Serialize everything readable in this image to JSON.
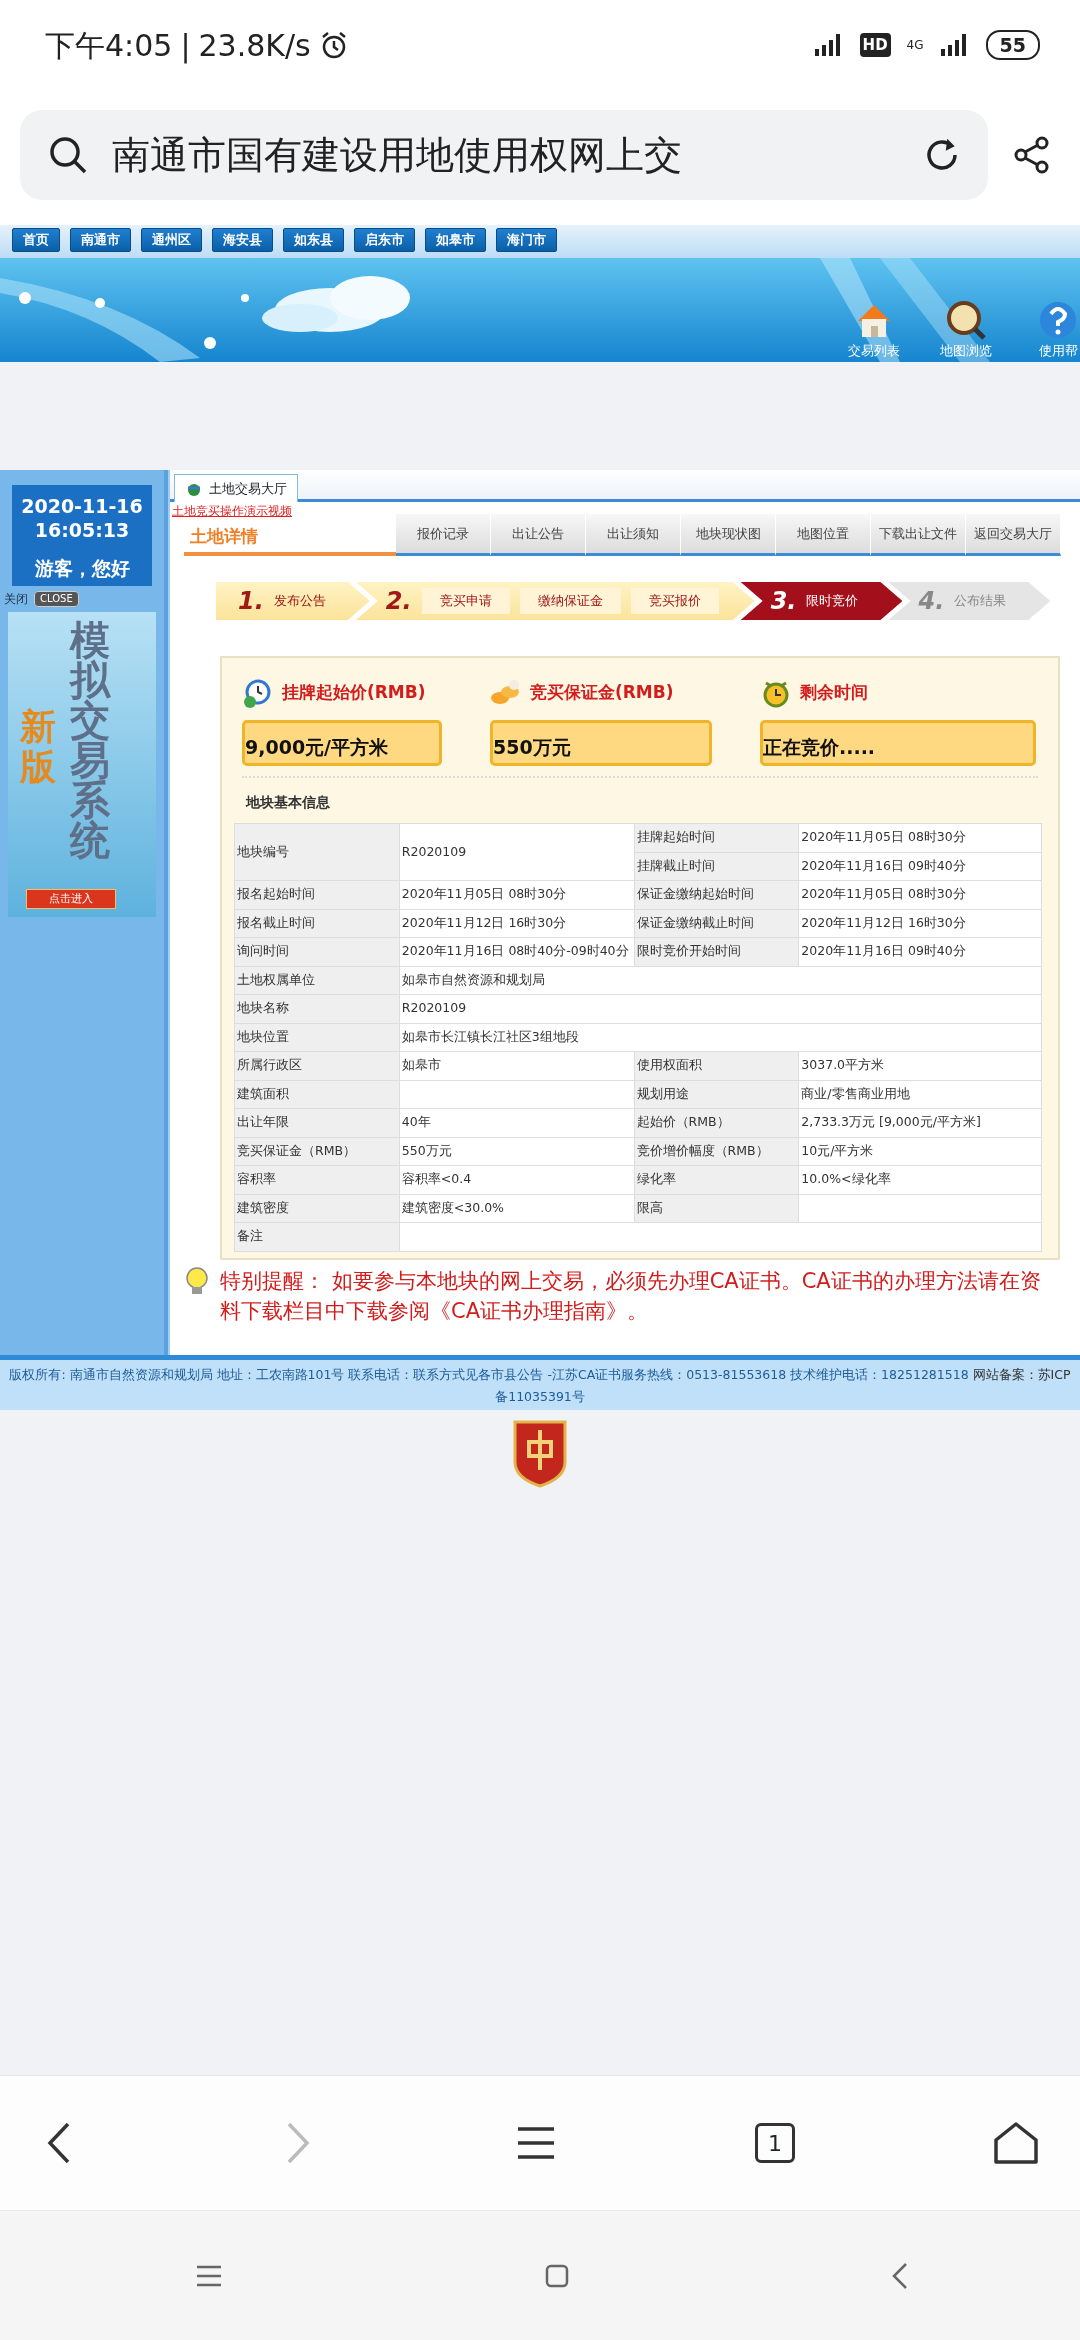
{
  "status_bar": {
    "time": "下午4:05",
    "divider": "|",
    "speed": "23.8K/s",
    "hd": "HD",
    "network": "4G",
    "battery": "55"
  },
  "browser": {
    "title": "南通市国有建设用地使用权网上交"
  },
  "site_nav": [
    {
      "label": "首页"
    },
    {
      "label": "南通市"
    },
    {
      "label": "通州区"
    },
    {
      "label": "海安县"
    },
    {
      "label": "如东县"
    },
    {
      "label": "启东市"
    },
    {
      "label": "如皋市"
    },
    {
      "label": "海门市"
    }
  ],
  "banner_tools": [
    {
      "kind": "house",
      "label": "交易列表"
    },
    {
      "kind": "map",
      "label": "地图浏览"
    },
    {
      "kind": "help",
      "label": "使用帮"
    }
  ],
  "left_panel": {
    "date": "2020-11-16",
    "time": "16:05:13",
    "greeting": "游客，您好",
    "close_label": "关闭",
    "close_button": "CLOSE",
    "ad": {
      "badge": "新版",
      "title": "模拟交易系统",
      "button": "点击进入"
    }
  },
  "main_tab": {
    "label": "土地交易大厅",
    "selected": true
  },
  "video_link": "土地竞买操作演示视频",
  "section_title": "土地详情",
  "detail_tabs": [
    {
      "label": "报价记录"
    },
    {
      "label": "出让公告"
    },
    {
      "label": "出让须知"
    },
    {
      "label": "地块现状图"
    },
    {
      "label": "地图位置"
    },
    {
      "label": "下载出让文件"
    },
    {
      "label": "返回交易大厅"
    }
  ],
  "steps": [
    {
      "num": "1.",
      "done": true,
      "selected": false,
      "labels": [
        "发布公告"
      ]
    },
    {
      "num": "2.",
      "done": true,
      "selected": false,
      "labels": [
        "竞买申请",
        "缴纳保证金",
        "竞买报价"
      ]
    },
    {
      "num": "3.",
      "done": false,
      "selected": true,
      "labels": [
        "限时竞价"
      ]
    },
    {
      "num": "4.",
      "done": false,
      "selected": false,
      "labels": [
        "公布结果"
      ]
    }
  ],
  "summary": [
    {
      "kind": "price",
      "label": "挂牌起始价(RMB)",
      "value": "9,000元/平方米"
    },
    {
      "kind": "deposit",
      "label": "竞买保证金(RMB)",
      "value": "550万元"
    },
    {
      "kind": "time",
      "label": "剩余时间",
      "value": "正在竞价....."
    }
  ],
  "info_title": "地块基本信息",
  "info_rows": [
    [
      {
        "kind": "label",
        "text": "地块编号",
        "tall": true
      },
      {
        "kind": "value",
        "text": "R2020109",
        "tall": true
      },
      {
        "kind": "label",
        "text": "挂牌起始时间"
      },
      {
        "kind": "value",
        "text": "2020年11月05日 08时30分"
      }
    ],
    [
      {
        "kind": "label",
        "text": "挂牌截止时间"
      },
      {
        "kind": "value",
        "text": "2020年11月16日 09时40分"
      }
    ],
    [
      {
        "kind": "label",
        "text": "报名起始时间"
      },
      {
        "kind": "value",
        "text": "2020年11月05日 08时30分"
      },
      {
        "kind": "label",
        "text": "保证金缴纳起始时间"
      },
      {
        "kind": "value",
        "text": "2020年11月05日 08时30分"
      }
    ],
    [
      {
        "kind": "label",
        "text": "报名截止时间"
      },
      {
        "kind": "value",
        "text": "2020年11月12日 16时30分"
      },
      {
        "kind": "label",
        "text": "保证金缴纳截止时间"
      },
      {
        "kind": "value",
        "text": "2020年11月12日 16时30分"
      }
    ],
    [
      {
        "kind": "label",
        "text": "询问时间"
      },
      {
        "kind": "value",
        "text": "2020年11月16日 08时40分-09时40分"
      },
      {
        "kind": "label",
        "text": "限时竞价开始时间"
      },
      {
        "kind": "value",
        "text": "2020年11月16日 09时40分"
      }
    ],
    [
      {
        "kind": "label",
        "text": "土地权属单位"
      },
      {
        "kind": "value",
        "text": "如皋市自然资源和规划局",
        "wide": true
      }
    ],
    [
      {
        "kind": "label",
        "text": "地块名称"
      },
      {
        "kind": "value",
        "text": "R2020109",
        "wide": true
      }
    ],
    [
      {
        "kind": "label",
        "text": "地块位置"
      },
      {
        "kind": "value",
        "text": "如皋市长江镇长江社区3组地段",
        "wide": true
      }
    ],
    [
      {
        "kind": "label",
        "text": "所属行政区"
      },
      {
        "kind": "value",
        "text": "如皋市"
      },
      {
        "kind": "label",
        "text": "使用权面积"
      },
      {
        "kind": "value",
        "text": "3037.0平方米"
      }
    ],
    [
      {
        "kind": "label",
        "text": "建筑面积"
      },
      {
        "kind": "value"
      },
      {
        "kind": "label",
        "text": "规划用途"
      },
      {
        "kind": "value",
        "text": "商业/零售商业用地"
      }
    ],
    [
      {
        "kind": "label",
        "text": "出让年限"
      },
      {
        "kind": "value",
        "text": "40年"
      },
      {
        "kind": "label",
        "text": "起始价（RMB）"
      },
      {
        "kind": "value",
        "text": "2,733.3万元 [9,000元/平方米]"
      }
    ],
    [
      {
        "kind": "label",
        "text": "竞买保证金（RMB）"
      },
      {
        "kind": "value",
        "text": "550万元"
      },
      {
        "kind": "label",
        "text": "竞价增价幅度（RMB）"
      },
      {
        "kind": "value",
        "text": "10元/平方米"
      }
    ],
    [
      {
        "kind": "label",
        "text": "容积率"
      },
      {
        "kind": "value",
        "text": "容积率<0.4"
      },
      {
        "kind": "label",
        "text": "绿化率"
      },
      {
        "kind": "value",
        "text": "10.0%<绿化率"
      }
    ],
    [
      {
        "kind": "label",
        "text": "建筑密度"
      },
      {
        "kind": "value",
        "text": "建筑密度<30.0%"
      },
      {
        "kind": "label",
        "text": "限高"
      },
      {
        "kind": "value"
      }
    ],
    [
      {
        "kind": "label",
        "text": "备注"
      },
      {
        "kind": "value",
        "wide": true
      }
    ]
  ],
  "notice": "特别提醒： 如要参与本地块的网上交易，必须先办理CA证书。CA证书的办理方法请在资料下载栏目中下载参阅《CA证书办理指南》。",
  "footer": {
    "text": "版权所有: 南通市自然资源和规划局 地址：工农南路101号 联系电话：联系方式见各市县公告 -江苏CA证书服务热线：0513-81553618 技术维护电话：18251281518",
    "record": "网站备案：苏ICP",
    "record_cont": "备11035391号"
  },
  "bottom_bar": {
    "tab_count": "1",
    "forward_disabled": true
  }
}
